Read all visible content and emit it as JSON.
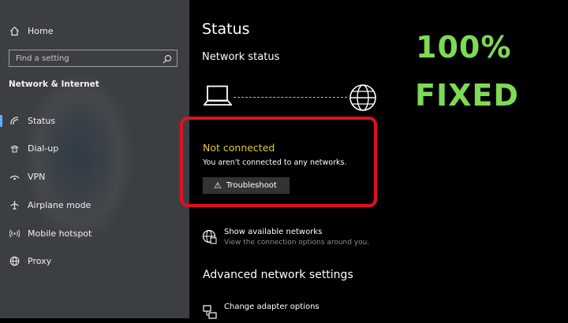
{
  "sidebar": {
    "home_label": "Home",
    "search_placeholder": "Find a setting",
    "section_title": "Network & Internet",
    "items": [
      {
        "label": "Status",
        "icon": "status-icon",
        "active": true
      },
      {
        "label": "Dial-up",
        "icon": "dial-up-icon"
      },
      {
        "label": "VPN",
        "icon": "vpn-icon"
      },
      {
        "label": "Airplane mode",
        "icon": "airplane-icon"
      },
      {
        "label": "Mobile hotspot",
        "icon": "hotspot-icon"
      },
      {
        "label": "Proxy",
        "icon": "globe-icon"
      }
    ]
  },
  "main": {
    "title": "Status",
    "network_status_heading": "Network status",
    "status_title": "Not connected",
    "status_message": "You aren't connected to any networks.",
    "troubleshoot_label": "Troubleshoot",
    "show_networks_title": "Show available networks",
    "show_networks_sub": "View the connection options around you.",
    "advanced_heading": "Advanced network settings",
    "adapter_title": "Change adapter options"
  },
  "overlay": {
    "line1": "100%",
    "line2": "FIXED",
    "color": "#7ed957",
    "highlight_color": "#e01020"
  },
  "colors": {
    "status_warning": "#e0c93a",
    "accent": "#6aa7ff"
  }
}
